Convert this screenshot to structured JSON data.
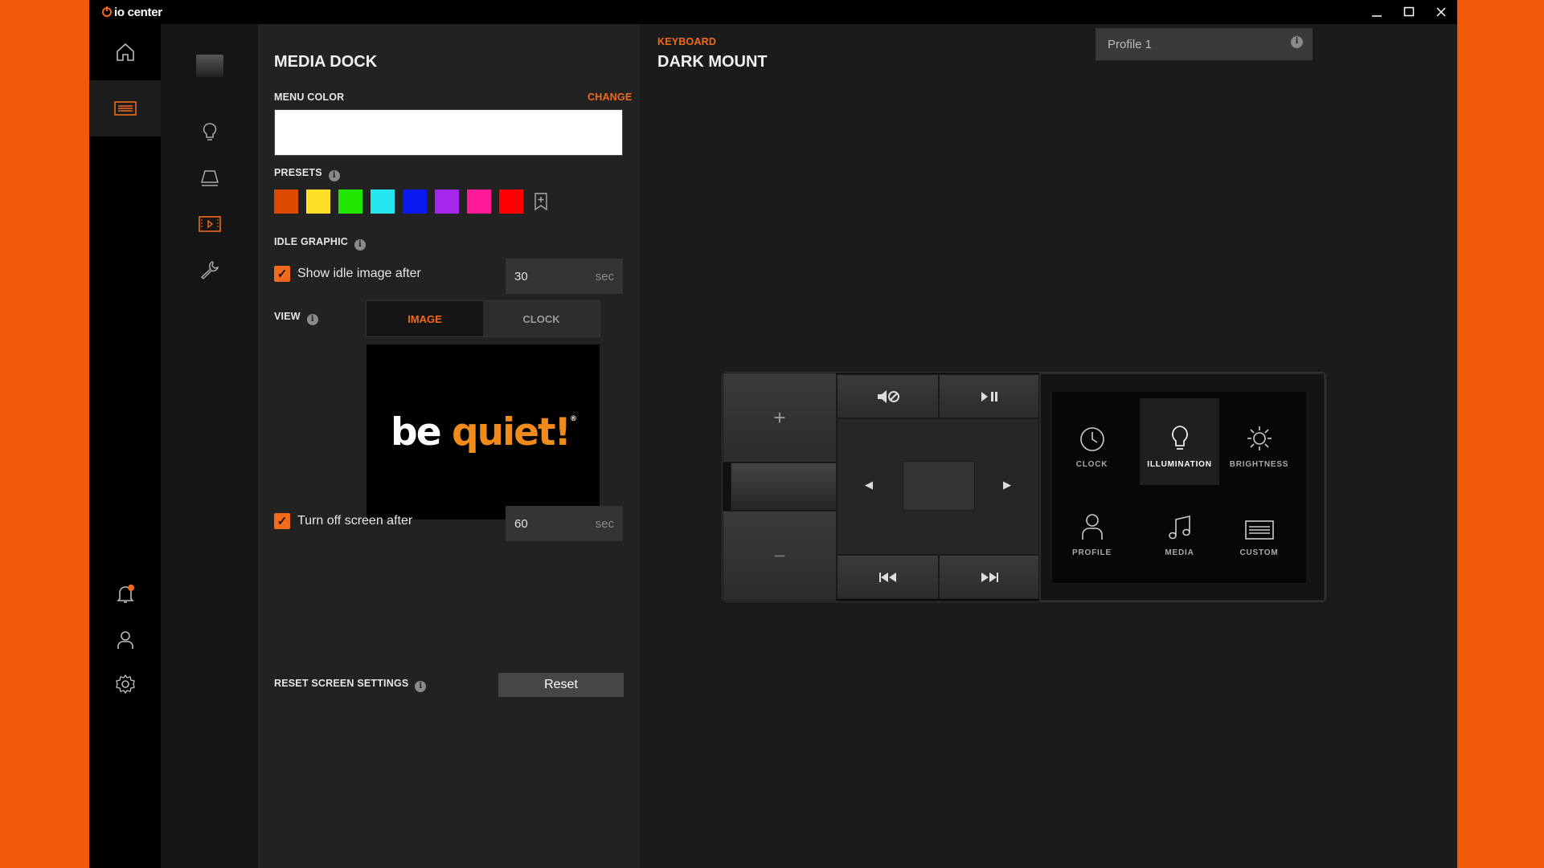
{
  "app": {
    "title": "io center",
    "window_buttons": [
      "minimize-icon",
      "maximize-icon",
      "close-icon"
    ]
  },
  "nav_primary": [
    "home-icon",
    "keyboard-icon",
    "bell-icon",
    "user-icon",
    "settings-icon"
  ],
  "nav_secondary": [
    "device-thumbnail",
    "bulb-icon",
    "desk-lamp-icon",
    "media-dock-icon",
    "wrench-icon"
  ],
  "panel": {
    "title": "MEDIA DOCK",
    "menu_color_label": "MENU COLOR",
    "change_label": "CHANGE",
    "menu_color": "#ffffff",
    "presets_label": "PRESETS",
    "presets": [
      "#e04a00",
      "#ffe026",
      "#22e600",
      "#26e6f0",
      "#0a1bf2",
      "#a726ee",
      "#ff1a9a",
      "#ff0000"
    ],
    "idle_label": "IDLE GRAPHIC",
    "show_idle_label": "Show idle image after",
    "show_idle_value": "30",
    "unit": "sec",
    "view_label": "VIEW",
    "view_options": [
      "IMAGE",
      "CLOCK"
    ],
    "logo_text_white": "be",
    "logo_text_orange": "quiet!",
    "logo_mark": "®",
    "turn_off_label": "Turn off screen after",
    "turn_off_value": "60",
    "reset_label": "RESET SCREEN SETTINGS",
    "reset_button": "Reset"
  },
  "main": {
    "category": "KEYBOARD",
    "device": "DARK MOUNT",
    "profile_selected": "Profile 1"
  },
  "dock": {
    "keys": {
      "plus": "+",
      "minus": "−",
      "left": "◀",
      "right": "▶"
    },
    "tiles": [
      "CLOCK",
      "ILLUMINATION",
      "BRIGHTNESS",
      "PROFILE",
      "MEDIA",
      "CUSTOM"
    ]
  },
  "colors": {
    "accent": "#f26a1b",
    "background": "#1b1b1b",
    "desktop": "#f05a0a"
  }
}
